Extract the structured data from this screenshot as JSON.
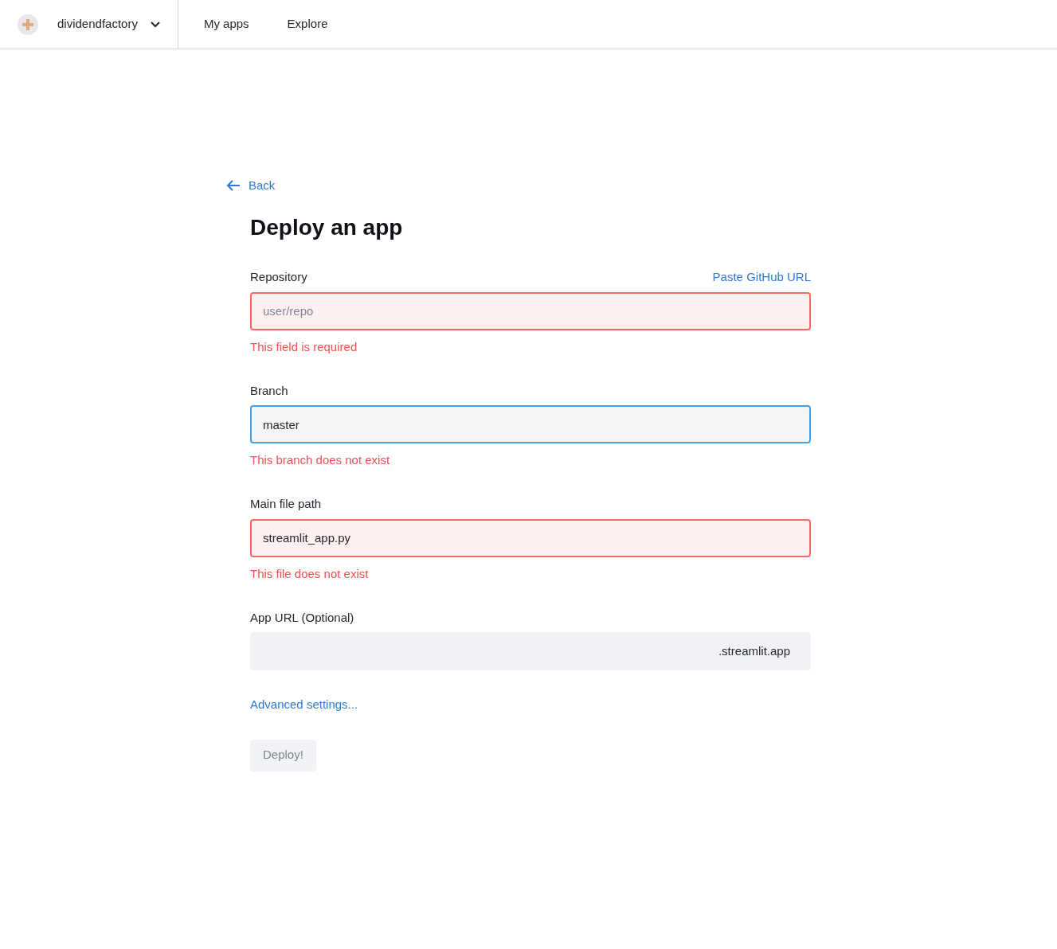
{
  "nav": {
    "account": "dividendfactory",
    "links": [
      "My apps",
      "Explore"
    ]
  },
  "back": "Back",
  "title": "Deploy an app",
  "fields": [
    {
      "label": "Repository",
      "action": "Paste GitHub URL",
      "placeholder": "user/repo",
      "error": true,
      "focused": false,
      "message": "This field is required"
    },
    {
      "label": "Branch",
      "value": "master",
      "error": false,
      "focused": true,
      "message": "This branch does not exist"
    },
    {
      "label": "Main file path",
      "value": "streamlit_app.py",
      "error": true,
      "focused": false,
      "message": "This file does not exist"
    },
    {
      "label": "App URL (Optional)",
      "suffix": ".streamlit.app",
      "error": false,
      "focused": false
    }
  ],
  "advanced": "Advanced settings...",
  "deploy": {
    "label": "Deploy!",
    "disabled": true
  }
}
